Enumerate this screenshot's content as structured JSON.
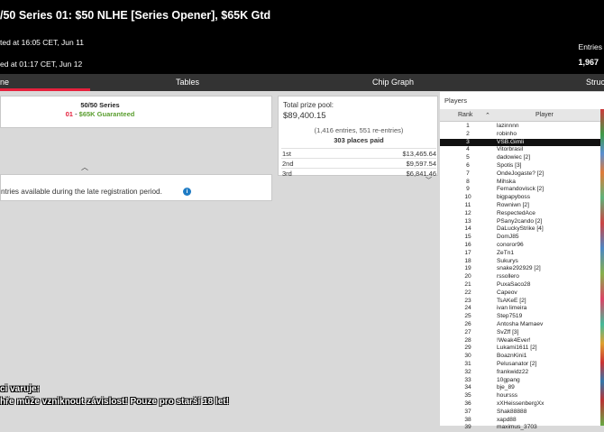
{
  "header": {
    "title": "/50 Series 01: $50 NLHE [Series Opener], $65K Gtd",
    "started": "ted at 16:05 CET, Jun 11",
    "ended": "ed at 01:17 CET, Jun 12",
    "entries_label": "Entries",
    "entries_value": "1,967"
  },
  "tabs": [
    {
      "label": "ne"
    },
    {
      "label": "Tables"
    },
    {
      "label": "Chip Graph"
    },
    {
      "label": "Struc"
    }
  ],
  "info": {
    "series_name": "50/50 Series",
    "series_num": "01",
    "dash": " - ",
    "guarantee": "$65K Guaranteed",
    "late_reg_text": "ntries available during the late registration period.",
    "info_icon_glyph": "i"
  },
  "prize": {
    "pool_label": "Total prize pool:",
    "pool_value": "$89,400.15",
    "entries_info": "(1,416 entries, 551 re-entries)",
    "places_paid": "303 places paid",
    "payouts": [
      {
        "place": "1st",
        "amount": "$13,465.64"
      },
      {
        "place": "2nd",
        "amount": "$9,597.54"
      },
      {
        "place": "3rd",
        "amount": "$6,841.46"
      }
    ]
  },
  "players": {
    "title": "Players",
    "col_rank": "Rank",
    "col_player": "Player",
    "sort_glyph": "⌃",
    "rows": [
      {
        "rank": "1",
        "name": "lazinnnn"
      },
      {
        "rank": "2",
        "name": "robinho"
      },
      {
        "rank": "3",
        "name": "VSB.Gimli"
      },
      {
        "rank": "4",
        "name": "Vitorbrasil"
      },
      {
        "rank": "5",
        "name": "dadowiec [2]"
      },
      {
        "rank": "6",
        "name": "Spotis [3]"
      },
      {
        "rank": "7",
        "name": "OndeJogaste? [2]"
      },
      {
        "rank": "8",
        "name": "Mihska"
      },
      {
        "rank": "9",
        "name": "Fernandovisck [2]"
      },
      {
        "rank": "10",
        "name": "bigpapyboss"
      },
      {
        "rank": "11",
        "name": "Rowniwn [2]"
      },
      {
        "rank": "12",
        "name": "RespectedAce"
      },
      {
        "rank": "13",
        "name": "PSany2cando [2]"
      },
      {
        "rank": "14",
        "name": "DaLuckyStrike [4]"
      },
      {
        "rank": "15",
        "name": "DomJ85"
      },
      {
        "rank": "16",
        "name": "conoror96"
      },
      {
        "rank": "17",
        "name": "ZeTn1"
      },
      {
        "rank": "18",
        "name": "Sukurys"
      },
      {
        "rank": "19",
        "name": "snake292929 [2]"
      },
      {
        "rank": "20",
        "name": "rssollero"
      },
      {
        "rank": "21",
        "name": "PuxaSaco28"
      },
      {
        "rank": "22",
        "name": "Capeov"
      },
      {
        "rank": "23",
        "name": "TsAKeE [2]"
      },
      {
        "rank": "24",
        "name": "ivan limeira"
      },
      {
        "rank": "25",
        "name": "Step7519"
      },
      {
        "rank": "26",
        "name": "Antosha Mamaev"
      },
      {
        "rank": "27",
        "name": "SvZff [3]"
      },
      {
        "rank": "28",
        "name": "!Weak4Ever!"
      },
      {
        "rank": "29",
        "name": "Lukami1611 [2]"
      },
      {
        "rank": "30",
        "name": "BoaznKini1"
      },
      {
        "rank": "31",
        "name": "Pelusanator [2]"
      },
      {
        "rank": "32",
        "name": "frankwidz22"
      },
      {
        "rank": "33",
        "name": "10gpang"
      },
      {
        "rank": "34",
        "name": "bje_89"
      },
      {
        "rank": "35",
        "name": "hoursss"
      },
      {
        "rank": "36",
        "name": "xXHeissenbergXx"
      },
      {
        "rank": "37",
        "name": "Shak88888"
      },
      {
        "rank": "38",
        "name": "xapd88"
      },
      {
        "rank": "39",
        "name": "maximus_3703"
      }
    ]
  },
  "warning": {
    "line1": "ci varuje:",
    "line2": "hře může vzniknout závislost! Pouze pro starší 18 let!"
  }
}
